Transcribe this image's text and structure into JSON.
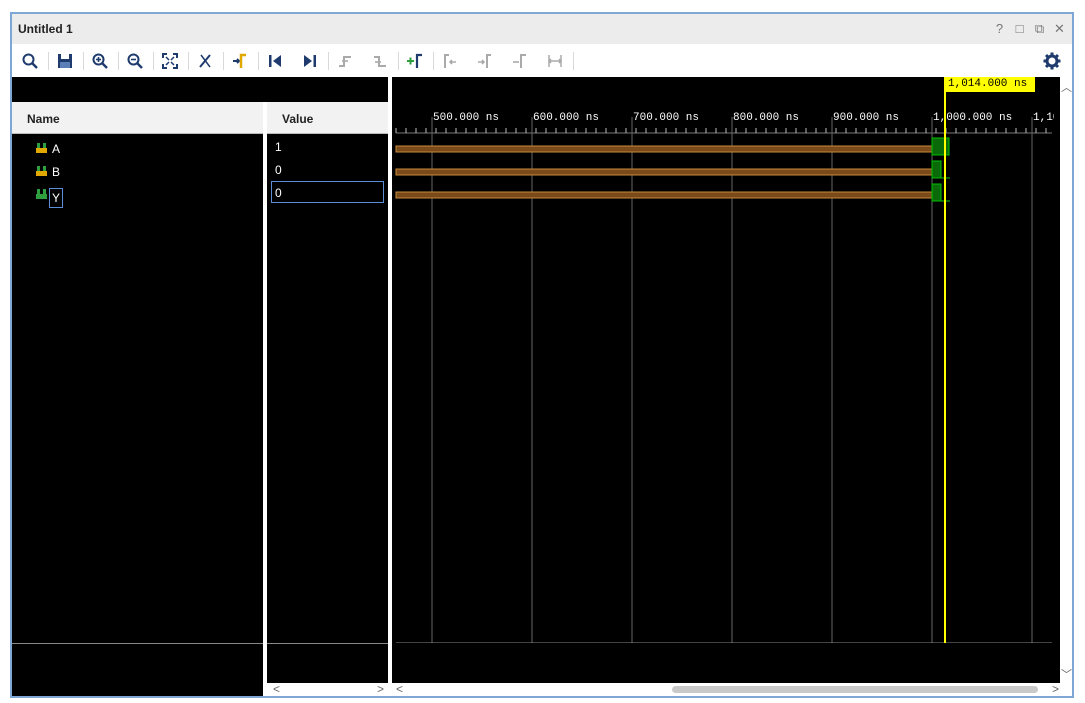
{
  "window": {
    "title": "Untitled 1",
    "controls": [
      "?",
      "□",
      "⧉",
      "✕"
    ]
  },
  "toolbar": {
    "buttons": [
      {
        "icon": "search-icon"
      },
      {
        "icon": "save-icon"
      },
      {
        "icon": "zoom-in-icon"
      },
      {
        "icon": "zoom-out-icon"
      },
      {
        "icon": "zoom-fit-icon"
      },
      {
        "icon": "go-to-cursor-icon"
      },
      {
        "icon": "go-to-time-zero-icon"
      },
      {
        "icon": "go-to-last-time-icon"
      },
      {
        "icon": "previous-transition-icon"
      },
      {
        "icon": "next-transition-icon"
      },
      {
        "icon": "add-marker-icon"
      },
      {
        "icon": "previous-marker-icon"
      },
      {
        "icon": "next-marker-icon"
      },
      {
        "icon": "swap-cursors-icon"
      },
      {
        "icon": "fix-cursor-icon"
      },
      {
        "icon": "floating-ruler-icon"
      }
    ],
    "settings_icon": "gear-icon"
  },
  "headers": {
    "name": "Name",
    "value": "Value"
  },
  "signals": [
    {
      "name": "A",
      "value": "1"
    },
    {
      "name": "B",
      "value": "0"
    },
    {
      "name": "Y",
      "value": "0"
    }
  ],
  "timeline": {
    "cursor_label": "1,014.000 ns",
    "tick_labels": [
      "500.000 ns",
      "600.000 ns",
      "700.000 ns",
      "800.000 ns",
      "900.000 ns",
      "1,000.000 ns",
      "1,10"
    ],
    "colors": {
      "bus": "#7a4a1a",
      "wave": "#00c000",
      "cursor": "#ffff00"
    }
  }
}
